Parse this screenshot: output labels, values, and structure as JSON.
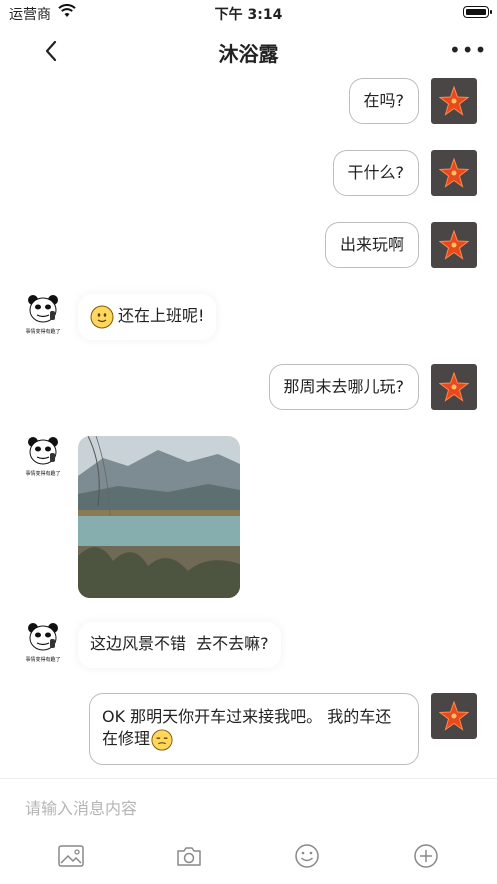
{
  "status_bar": {
    "carrier": "运营商",
    "time": "下午 3:14"
  },
  "nav": {
    "title": "沐浴露"
  },
  "messages": [
    {
      "from": "me",
      "text": "在吗?"
    },
    {
      "from": "me",
      "text": "干什么?"
    },
    {
      "from": "me",
      "text": "出来玩啊"
    },
    {
      "from": "other",
      "text": "还在上班呢!",
      "emoji": "smile-face"
    },
    {
      "from": "me",
      "text": "那周末去哪儿玩?"
    },
    {
      "from": "other",
      "type": "image",
      "description": "lake-landscape-photo"
    },
    {
      "from": "other",
      "text": "这边风景不错  去不去嘛?"
    },
    {
      "from": "me",
      "line1": "OK 那明天你开车过来接我吧。 我的车还",
      "line2": "在修理",
      "emoji": "unamused-face"
    }
  ],
  "other_avatar_caption": "事情变得有趣了",
  "input": {
    "placeholder": "请输入消息内容"
  },
  "toolbar": [
    "image-icon",
    "camera-icon",
    "emoji-icon",
    "plus-icon"
  ],
  "colors": {
    "self_avatar_bg": "#4a4646",
    "starfish": "#e8491d",
    "bubble_border": "#bdbdbd"
  }
}
